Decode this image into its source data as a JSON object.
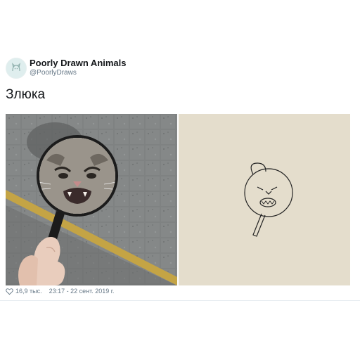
{
  "author": {
    "display_name": "Poorly Drawn Animals",
    "handle": "@PoorlyDraws",
    "avatar_icon": "cat-doodle-icon"
  },
  "tweet": {
    "text": "Злюка"
  },
  "media": {
    "left_image": "angry-cat-magnifier-photo",
    "right_image": "cat-doodle-drawing"
  },
  "footer": {
    "like_icon": "heart-icon",
    "likes": "16,9 тыс.",
    "timestamp": "23:17 - 22 сент. 2019 г."
  },
  "colors": {
    "secondary_text": "#657786",
    "primary_text": "#14171a"
  }
}
